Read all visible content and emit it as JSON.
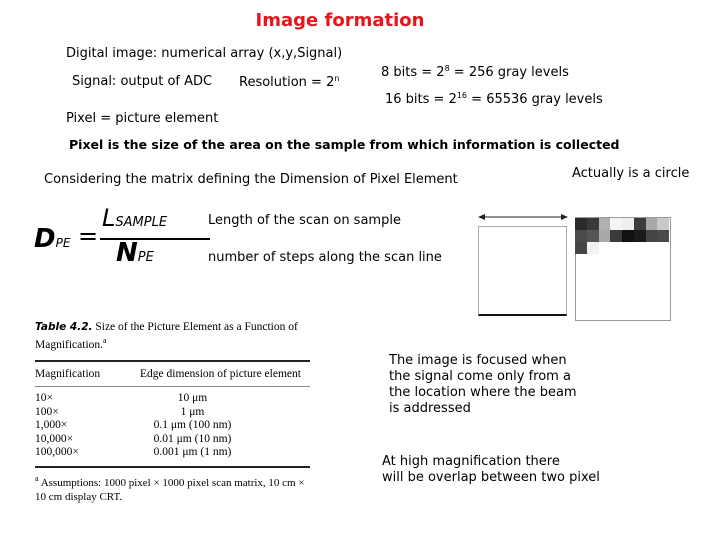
{
  "title": "Image formation",
  "top": {
    "digital_image": "Digital image: numerical array (x,y,Signal)",
    "signal_label": "Signal: output of ADC",
    "resolution_label": "Resolution = 2",
    "resolution_exp": "n",
    "pixel_def": "Pixel = picture element",
    "bits8_pre": "8 bits = 2",
    "bits8_exp": "8",
    "bits8_post": " = 256 gray levels",
    "bits16_pre": "16 bits = 2",
    "bits16_exp": "16",
    "bits16_post": " = 65536 gray levels"
  },
  "pixel_statement": "Pixel is the size of the area on the sample from which information is collected",
  "matrix_statement": "Considering the matrix defining the Dimension of Pixel Element",
  "circle_note": "Actually is a circle",
  "formula": {
    "lhs": "D",
    "lhs_sub": "PE",
    "equals": "=",
    "numerator": "L",
    "numerator_sub": "SAMPLE",
    "denominator": "N",
    "denominator_sub": "PE",
    "numerator_desc": "Length of the scan on sample",
    "denominator_desc": "number of steps along the scan line"
  },
  "pixel_grid": {
    "rows": [
      [
        "#2a2a2a",
        "#3a3a3a",
        "#b0b0b0",
        "#f4f4f4",
        "#f0f0f0",
        "#3c3c3c",
        "#a8a8a8",
        "#c8c8c8"
      ],
      [
        "#4a4a4a",
        "#555555",
        "#a8a8a8",
        "#3a3a3a",
        "#111111",
        "#1a1a1a",
        "#444444",
        "#4a4a4a"
      ],
      [
        "#444444",
        "#f2f2f2"
      ]
    ]
  },
  "table": {
    "label": "Table 4.2.",
    "caption": " Size of the Picture Element as a Function of Magnification.",
    "caption_mark": "a",
    "headers": [
      "Magnification",
      "Edge dimension of picture element"
    ],
    "rows": [
      [
        "10×",
        "10 μm"
      ],
      [
        "100×",
        "1 μm"
      ],
      [
        "1,000×",
        "0.1 μm (100 nm)"
      ],
      [
        "10,000×",
        "0.01 μm (10 nm)"
      ],
      [
        "100,000×",
        "0.001 μm (1 nm)"
      ]
    ],
    "footnote_mark": "a",
    "footnote": " Assumptions: 1000 pixel × 1000 pixel scan matrix, 10 cm × 10 cm display CRT."
  },
  "focus_note": "The image is focused when\nthe signal come only from a\nthe location where the beam\nis addressed",
  "overlap_note": "At high magnification there\nwill be overlap between two pixel"
}
